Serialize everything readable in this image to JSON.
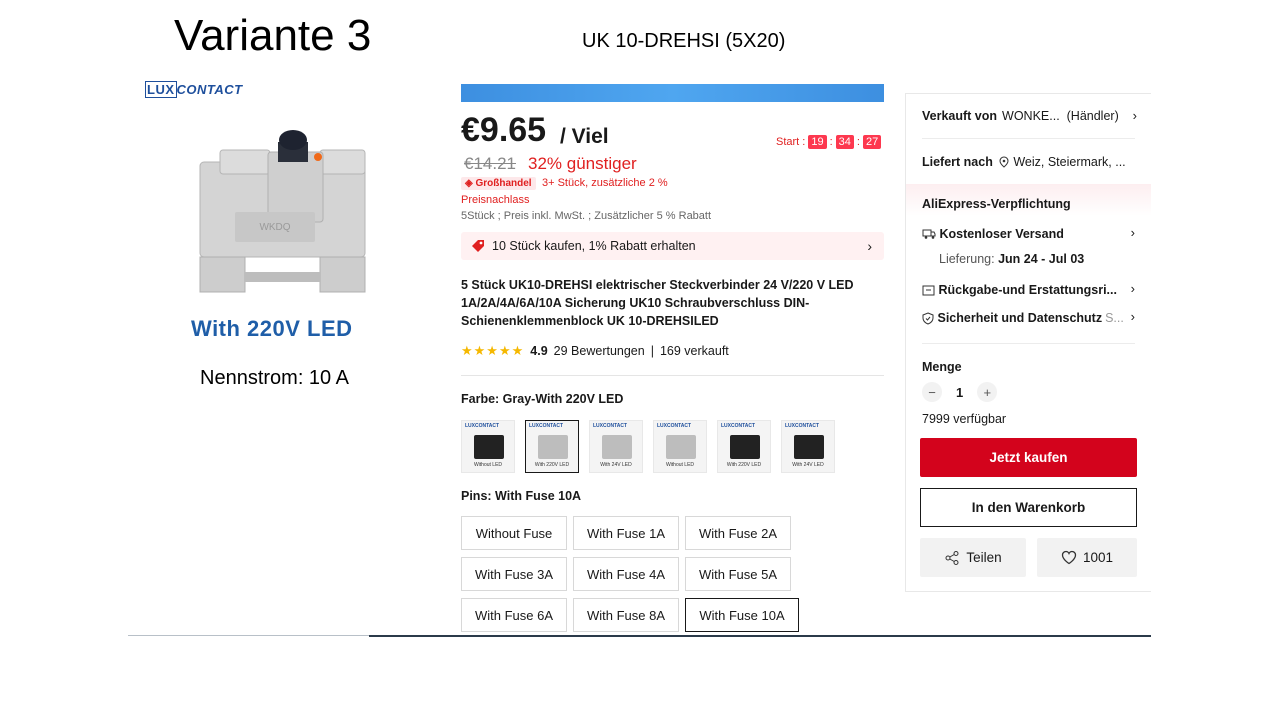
{
  "slide": {
    "title": "Variante 3",
    "subtitle": "UK 10-DREHSI (5X20)"
  },
  "left": {
    "brand_box": "LUX",
    "brand_rest": "CONTACT",
    "device_marking": "WKDQ",
    "led_label": "With 220V LED",
    "nennstrom": "Nennstrom: 10 A"
  },
  "price": {
    "main": "€9.65",
    "unit": "/ Viel",
    "old": "€14.21",
    "discount": "32% günstiger",
    "countdown_label": "Start :",
    "countdown_h": "19",
    "countdown_m": "34",
    "countdown_s": "27",
    "wholesale_badge": "Großhandel",
    "wholesale_text": "3+ Stück, zusätzliche 2 %",
    "wholesale_text2": "Preisnachlass",
    "tax_note": "5Stück ; Preis inkl. MwSt. ; Zusätzlicher 5 % Rabatt",
    "promo": "10 Stück kaufen, 1% Rabatt erhalten"
  },
  "product": {
    "title": "5 Stück UK10-DREHSI elektrischer Steckverbinder 24 V/220 V LED 1A/2A/4A/6A/10A Sicherung UK10 Schraubverschluss DIN-Schienenklemmenblock UK 10-DREHSILED",
    "stars": "★★★★★",
    "rating": "4.9",
    "reviews": "29 Bewertungen",
    "sep": "|",
    "sold": "169 verkauft"
  },
  "color": {
    "label": "Farbe: Gray-With 220V LED",
    "swatches": [
      {
        "caption": "Without LED",
        "tone": "dark"
      },
      {
        "caption": "With 220V LED",
        "tone": "grey"
      },
      {
        "caption": "With 24V LED",
        "tone": "grey"
      },
      {
        "caption": "Without LED",
        "tone": "grey"
      },
      {
        "caption": "With 220V LED",
        "tone": "dark"
      },
      {
        "caption": "With 24V LED",
        "tone": "dark"
      }
    ],
    "swatch_brand": "LUXCONTACT"
  },
  "pins": {
    "label": "Pins: With Fuse 10A",
    "options": [
      "Without Fuse",
      "With Fuse 1A",
      "With Fuse 2A",
      "With Fuse 3A",
      "With Fuse 4A",
      "With Fuse 5A",
      "With Fuse 6A",
      "With Fuse 8A",
      "With Fuse 10A"
    ],
    "selected_index": 8
  },
  "side": {
    "seller_label": "Verkauft von",
    "seller_name": "WONKE...",
    "seller_type": "(Händler)",
    "ship_label": "Liefert nach",
    "ship_location": "Weiz, Steiermark, ...",
    "commitment": "AliExpress-Verpflichtung",
    "free_shipping": "Kostenloser Versand",
    "delivery_label": "Lieferung:",
    "delivery_date": "Jun 24 - Jul 03",
    "returns": "Rückgabe-und Erstattungsri...",
    "security": "Sicherheit und Datenschutz",
    "security_more": "S...",
    "qty_label": "Menge",
    "qty_minus": "−",
    "qty_value": "1",
    "qty_plus": "+",
    "stock": "7999 verfügbar",
    "buy_now": "Jetzt kaufen",
    "add_cart": "In den Warenkorb",
    "share": "Teilen",
    "wishlist_count": "1001"
  },
  "colors": {
    "accent_red": "#d3031c",
    "price_red": "#e02020",
    "star": "#f5b800",
    "led_blue": "#1f5ea8"
  }
}
